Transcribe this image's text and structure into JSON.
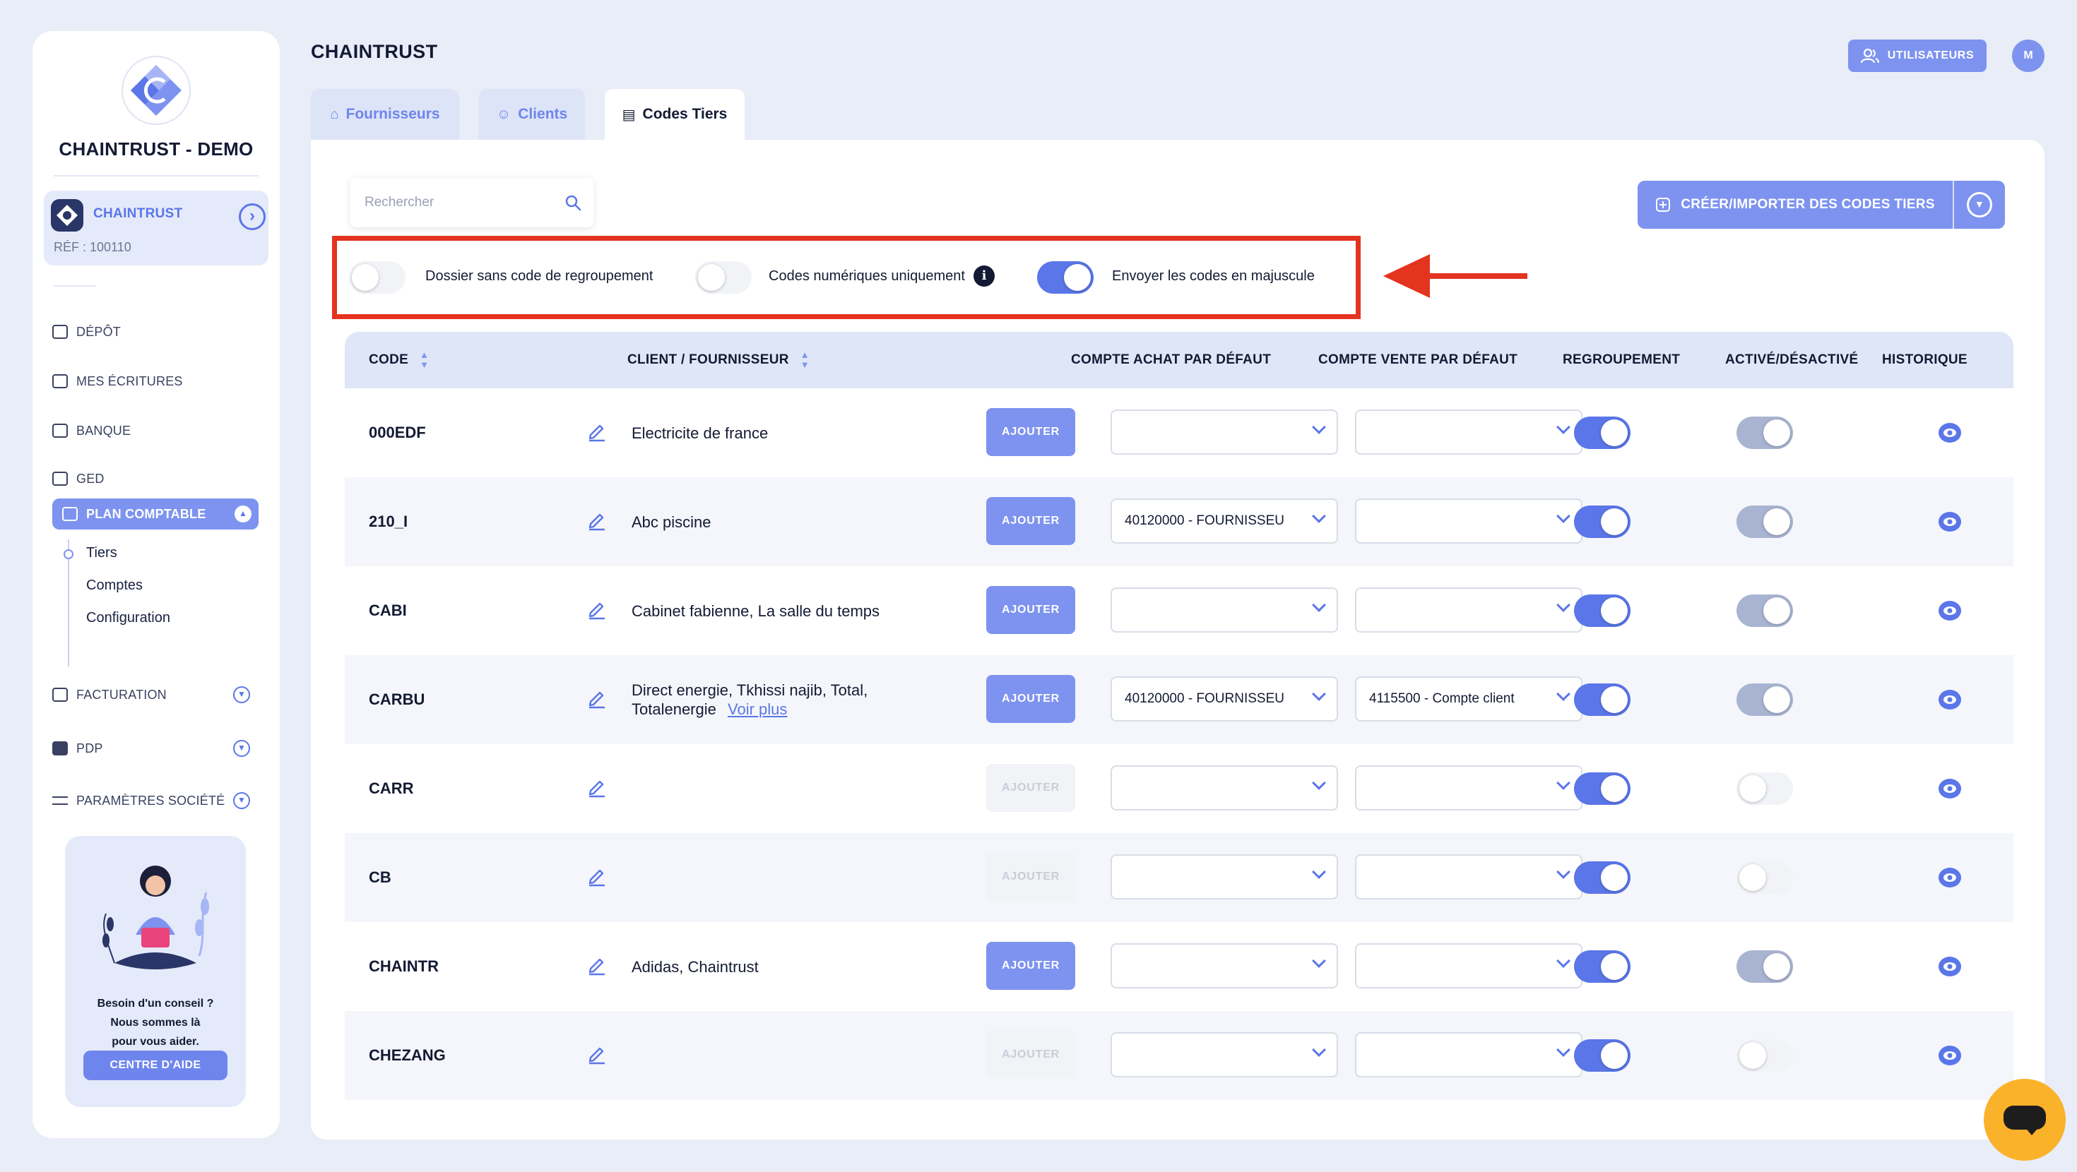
{
  "sidebar": {
    "company": "CHAINTRUST - DEMO",
    "client_name": "CHAINTRUST",
    "client_ref": "RÉF : 100110",
    "nav": {
      "depot": "DÉPÔT",
      "ecritures": "MES ÉCRITURES",
      "banque": "BANQUE",
      "ged": "GED",
      "plan": "PLAN COMPTABLE",
      "facturation": "FACTURATION",
      "pdp": "PDP",
      "parametres": "PARAMÈTRES SOCIÉTÉ"
    },
    "sub": {
      "tiers": "Tiers",
      "comptes": "Comptes",
      "config": "Configuration"
    },
    "help": {
      "line1": "Besoin d'un conseil ?",
      "line2": "Nous sommes là",
      "line3": "pour vous aider.",
      "button": "CENTRE D'AIDE"
    }
  },
  "header": {
    "title": "CHAINTRUST",
    "users_button": "UTILISATEURS",
    "avatar": "M"
  },
  "tabs": {
    "fournisseurs": "Fournisseurs",
    "clients": "Clients",
    "codes": "Codes Tiers"
  },
  "toolbar": {
    "search_placeholder": "Rechercher",
    "create_button": "CRÉER/IMPORTER DES CODES TIERS"
  },
  "options": {
    "sans_code": {
      "label": "Dossier sans code de regroupement",
      "on": false
    },
    "numeriques": {
      "label": "Codes numériques uniquement",
      "on": false
    },
    "majuscule": {
      "label": "Envoyer les codes en majuscule",
      "on": true
    }
  },
  "table": {
    "headers": {
      "code": "CODE",
      "client": "CLIENT / FOURNISSEUR",
      "achat": "COMPTE ACHAT PAR DÉFAUT",
      "vente": "COMPTE VENTE PAR DÉFAUT",
      "regroupement": "REGROUPEMENT",
      "active": "ACTIVÉ/DÉSACTIVÉ",
      "historique": "HISTORIQUE"
    },
    "add_label": "AJOUTER",
    "rows": [
      {
        "code": "000EDF",
        "client": "Electricite de france",
        "more": "",
        "achat": "",
        "vente": "",
        "add_enabled": true,
        "regroupement": true,
        "active": true
      },
      {
        "code": "210_I",
        "client": "Abc piscine",
        "more": "",
        "achat": "40120000 - FOURNISSEU",
        "vente": "",
        "add_enabled": true,
        "regroupement": true,
        "active": true
      },
      {
        "code": "CABI",
        "client": "Cabinet fabienne, La salle du temps",
        "more": "",
        "achat": "",
        "vente": "",
        "add_enabled": true,
        "regroupement": true,
        "active": true
      },
      {
        "code": "CARBU",
        "client": "Direct energie, Tkhissi najib, Total, Totalenergie",
        "more": "Voir plus",
        "achat": "40120000 - FOURNISSEU",
        "vente": "4115500 - Compte client",
        "add_enabled": true,
        "regroupement": true,
        "active": true
      },
      {
        "code": "CARR",
        "client": "",
        "more": "",
        "achat": "",
        "vente": "",
        "add_enabled": false,
        "regroupement": true,
        "active": false
      },
      {
        "code": "CB",
        "client": "",
        "more": "",
        "achat": "",
        "vente": "",
        "add_enabled": false,
        "regroupement": true,
        "active": false
      },
      {
        "code": "CHAINTR",
        "client": "Adidas, Chaintrust",
        "more": "",
        "achat": "",
        "vente": "",
        "add_enabled": true,
        "regroupement": true,
        "active": true
      },
      {
        "code": "CHEZANG",
        "client": "",
        "more": "",
        "achat": "",
        "vente": "",
        "add_enabled": false,
        "regroupement": true,
        "active": false
      }
    ]
  },
  "colors": {
    "accent": "#7d93ef",
    "primary": "#5a76e8",
    "highlight": "#e4331f",
    "chat": "#fbb22b"
  }
}
